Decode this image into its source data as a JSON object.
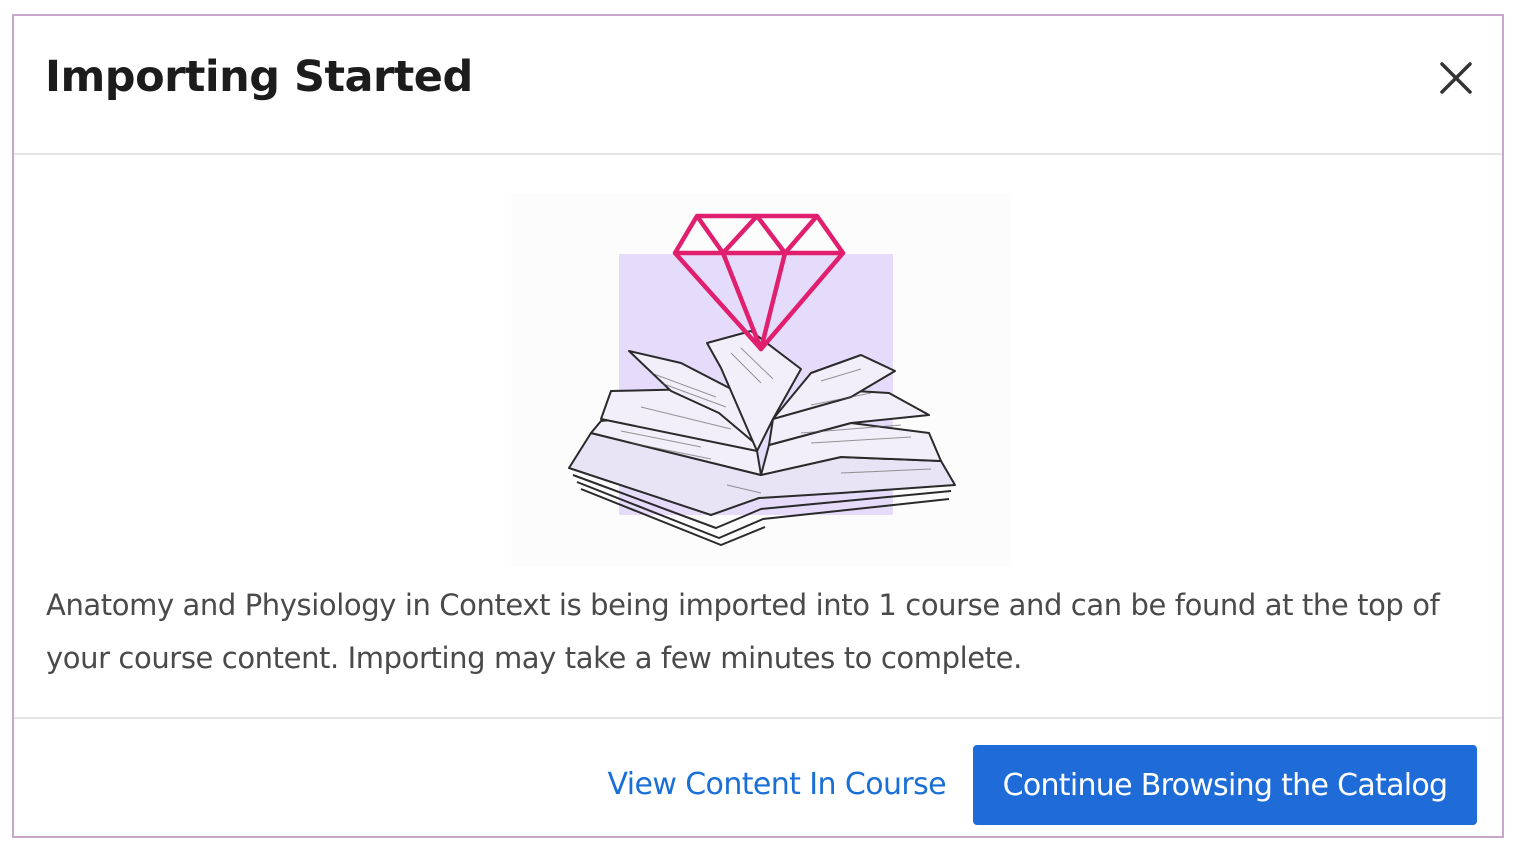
{
  "dialog": {
    "title": "Importing Started",
    "close_icon": "close-icon",
    "illustration": "open-book-with-diamond-illustration",
    "message": "Anatomy and Physiology in Context is being imported into 1 course and can be found at the top of your course content. Importing may take a few minutes to complete.",
    "secondary_action_label": "View Content In Course",
    "primary_action_label": "Continue Browsing the Catalog"
  },
  "colors": {
    "primary": "#1f6cd8",
    "link": "#1a6fd6",
    "accent_diamond": "#e0206f",
    "illustration_backdrop": "#e4dcfa",
    "dialog_border": "#c9a6cc"
  }
}
